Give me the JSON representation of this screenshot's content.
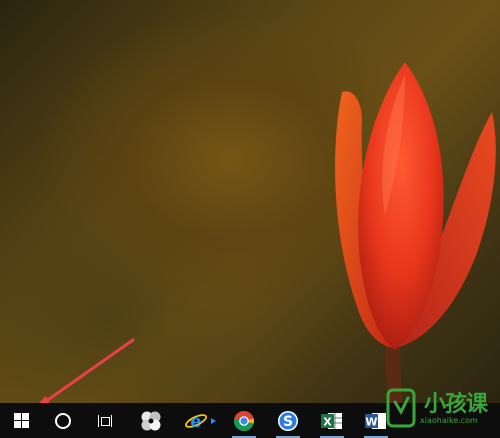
{
  "desktop": {
    "wallpaper": "red-tulip-bud",
    "annotation": "red-arrow-pointing-to-start"
  },
  "colors": {
    "taskbar_bg": "#0d0d0d",
    "arrow_red": "#e8414a",
    "tulip_red": "#e84a2a",
    "watermark_green": "#3aa63a"
  },
  "taskbar": {
    "icons": [
      {
        "name": "windows-start-icon"
      },
      {
        "name": "cortana-search-icon"
      },
      {
        "name": "task-view-icon"
      },
      {
        "name": "pinwheel-app-icon"
      },
      {
        "name": "internet-explorer-icon"
      },
      {
        "name": "chrome-icon"
      },
      {
        "name": "sogou-browser-icon"
      },
      {
        "name": "excel-icon"
      },
      {
        "name": "word-icon"
      }
    ],
    "ie_glyph": "e",
    "sogou_glyph": "S",
    "excel_glyph": "X",
    "word_glyph": "W"
  },
  "watermark": {
    "text": "小孩课",
    "sub": "xiaohaike.com"
  }
}
